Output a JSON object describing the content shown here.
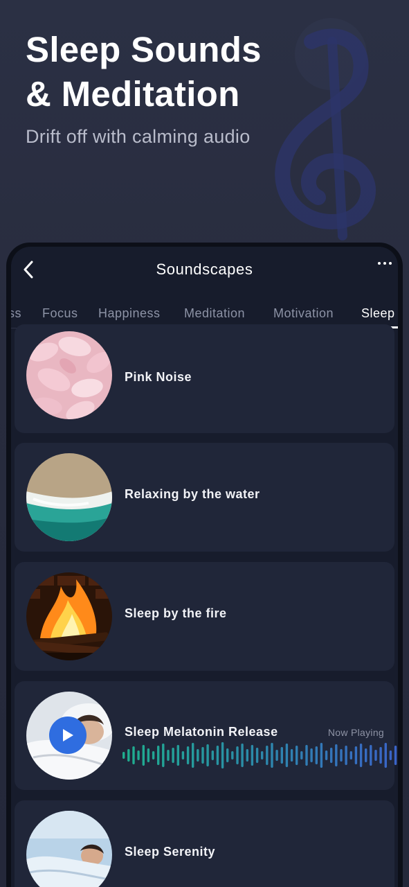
{
  "hero": {
    "title_line1": "Sleep Sounds",
    "title_line2": "& Meditation",
    "subtitle": "Drift off with calming audio"
  },
  "header": {
    "title": "Soundscapes",
    "back_icon": "chevron-left-icon",
    "more_icon": "more-horizontal-icon"
  },
  "tabs": [
    {
      "label": "ss",
      "active": false
    },
    {
      "label": "Focus",
      "active": false
    },
    {
      "label": "Happiness",
      "active": false
    },
    {
      "label": "Meditation",
      "active": false
    },
    {
      "label": "Motivation",
      "active": false
    },
    {
      "label": "Sleep",
      "active": true
    }
  ],
  "tracks": [
    {
      "title": "Pink Noise",
      "image": "rose-petals"
    },
    {
      "title": "Relaxing by the water",
      "image": "beach-aerial"
    },
    {
      "title": "Sleep by the fire",
      "image": "fireplace"
    },
    {
      "title": "Sleep Melatonin Release",
      "image": "sleeping-woman",
      "status": "Now Playing",
      "playing": true
    },
    {
      "title": "Sleep Serenity",
      "image": "woman-in-bed"
    }
  ],
  "colors": {
    "accent": "#2f6de0",
    "wave_start": "#1fae8e",
    "wave_end": "#3a64c8",
    "card": "#202639",
    "background": "#282c3e"
  }
}
